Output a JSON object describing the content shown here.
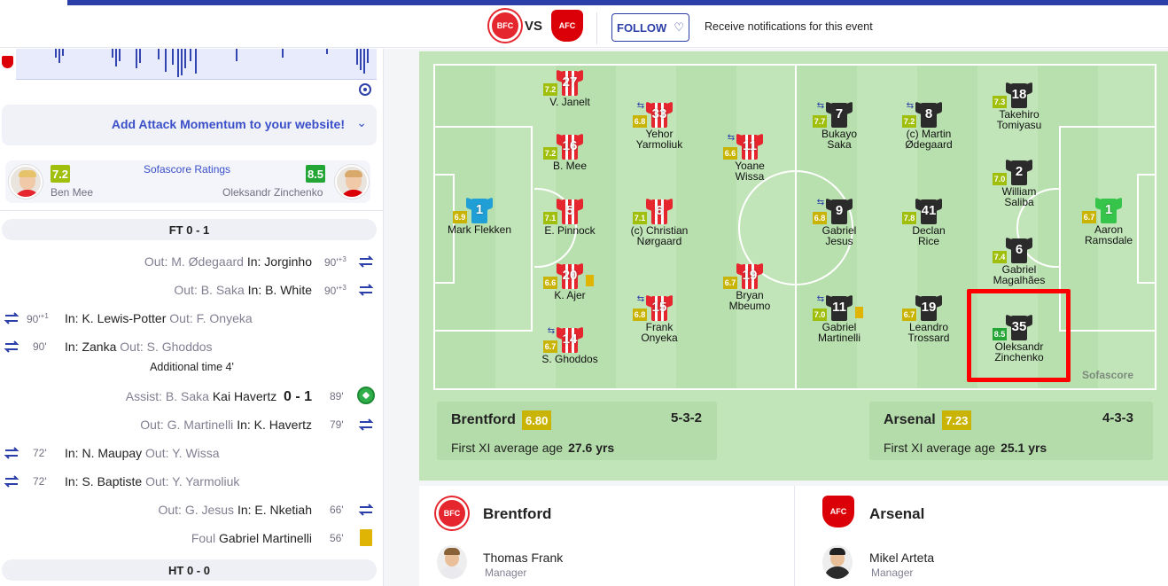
{
  "header": {
    "home_crest": "BFC",
    "away_crest": "AFC",
    "vs": "VS",
    "follow": "FOLLOW",
    "notif": "Receive notifications for this event"
  },
  "momentum": {
    "add_label": "Add Attack Momentum to your website!"
  },
  "ratings": {
    "title": "Sofascore Ratings",
    "home_player": "Ben Mee",
    "home_rating": "7.2",
    "away_player": "Oleksandr Zinchenko",
    "away_rating": "8.5"
  },
  "timeline": {
    "ft": "FT 0 - 1",
    "ht": "HT 0 - 0",
    "additional": "Additional time 4'",
    "e1": {
      "out": "Out: M. Ødegaard",
      "in": "In: Jorginho",
      "min": "90'",
      "extra": "+3"
    },
    "e2": {
      "out": "Out: B. Saka",
      "in": "In: B. White",
      "min": "90'",
      "extra": "+3"
    },
    "e3": {
      "in": "In: K. Lewis-Potter",
      "out": "Out: F. Onyeka",
      "min": "90'",
      "extra": "+1"
    },
    "e4": {
      "in": "In: Zanka",
      "out": "Out: S. Ghoddos",
      "min": "90'"
    },
    "e5": {
      "assist": "Assist: B. Saka",
      "scorer": "Kai Havertz",
      "score": "0 - 1",
      "min": "89'"
    },
    "e6": {
      "out": "Out: G. Martinelli",
      "in": "In: K. Havertz",
      "min": "79'"
    },
    "e7": {
      "in": "In: N. Maupay",
      "out": "Out: Y. Wissa",
      "min": "72'"
    },
    "e8": {
      "in": "In: S. Baptiste",
      "out": "Out: Y. Yarmoliuk",
      "min": "72'"
    },
    "e9": {
      "out": "Out: G. Jesus",
      "in": "In: E. Nketiah",
      "min": "66'"
    },
    "e10": {
      "label": "Foul",
      "player": "Gabriel Martinelli",
      "min": "56'"
    }
  },
  "lineup": {
    "home": [
      {
        "num": "1",
        "name": "Mark Flekken",
        "rating": "6.9"
      },
      {
        "num": "27",
        "name": "V. Janelt",
        "rating": "7.2"
      },
      {
        "num": "16",
        "name": "B. Mee",
        "rating": "7.2"
      },
      {
        "num": "5",
        "name": "E. Pinnock",
        "rating": "7.1"
      },
      {
        "num": "20",
        "name": "K. Ajer",
        "rating": "6.6"
      },
      {
        "num": "14",
        "name": "S. Ghoddos",
        "rating": "6.7"
      },
      {
        "num": "33",
        "name": "Yehor Yarmoliuk",
        "rating": "6.8"
      },
      {
        "num": "6",
        "name": "(c) Christian Nørgaard",
        "rating": "7.1"
      },
      {
        "num": "15",
        "name": "Frank Onyeka",
        "rating": "6.8"
      },
      {
        "num": "11",
        "name": "Yoane Wissa",
        "rating": "6.6"
      },
      {
        "num": "19",
        "name": "Bryan Mbeumo",
        "rating": "6.7"
      }
    ],
    "away": [
      {
        "num": "7",
        "name": "Bukayo Saka",
        "rating": "7.7"
      },
      {
        "num": "9",
        "name": "Gabriel Jesus",
        "rating": "6.8"
      },
      {
        "num": "11",
        "name": "Gabriel Martinelli",
        "rating": "7.0"
      },
      {
        "num": "8",
        "name": "(c) Martin Ødegaard",
        "rating": "7.2"
      },
      {
        "num": "41",
        "name": "Declan Rice",
        "rating": "7.8"
      },
      {
        "num": "19",
        "name": "Leandro Trossard",
        "rating": "6.7"
      },
      {
        "num": "18",
        "name": "Takehiro Tomiyasu",
        "rating": "7.3"
      },
      {
        "num": "2",
        "name": "William Saliba",
        "rating": "7.0"
      },
      {
        "num": "6",
        "name": "Gabriel Magalhães",
        "rating": "7.4"
      },
      {
        "num": "35",
        "name": "Oleksandr Zinchenko",
        "rating": "8.5"
      },
      {
        "num": "1",
        "name": "Aaron Ramsdale",
        "rating": "6.7"
      }
    ],
    "watermark": "Sofascore"
  },
  "teams": {
    "home": {
      "name": "Brentford",
      "rating": "6.80",
      "formation": "5-3-2",
      "age_label": "First XI average age",
      "age": "27.6 yrs",
      "manager": "Thomas Frank",
      "manager_role": "Manager"
    },
    "away": {
      "name": "Arsenal",
      "rating": "7.23",
      "formation": "4-3-3",
      "age_label": "First XI average age",
      "age": "25.1 yrs",
      "manager": "Mikel Arteta",
      "manager_role": "Manager"
    }
  },
  "colors": {
    "accent": "#2c3ea8",
    "home_shirt": "#e5262e",
    "away_shirt": "#2b2b2b",
    "gk_home": "#1f9fd6",
    "gk_away": "#37c44a"
  }
}
